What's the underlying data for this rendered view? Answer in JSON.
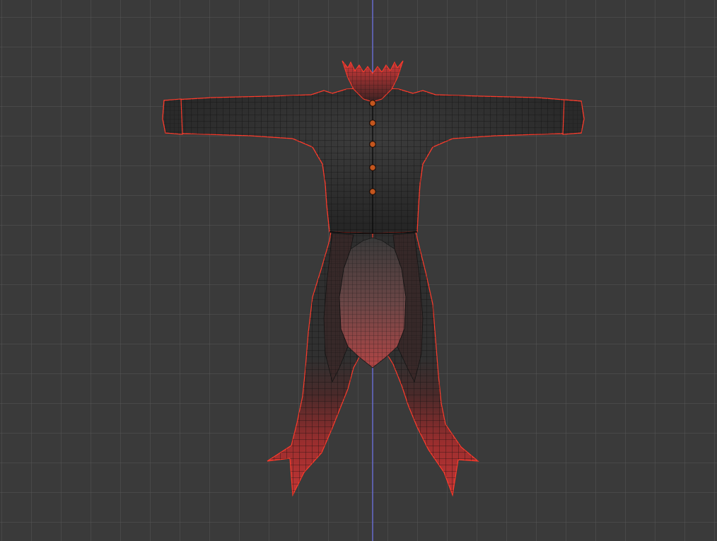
{
  "viewport": {
    "view": "front-orthographic",
    "mode": "edit-wireframe-overlay",
    "background_color": "#3a3a3a",
    "grid": {
      "visible": true,
      "line_color": "#575757",
      "center_axis_color": "#6a6fd6"
    }
  },
  "mesh": {
    "object": "long-coat-with-stand-collar",
    "base_color": "#2e2e2e",
    "gradient_color": "#c03535",
    "wire_color": "#0d0d0d",
    "silhouette_color": "#ff3b2b",
    "selected": true
  },
  "buttons": {
    "count": 5,
    "color": "#c4561e"
  }
}
